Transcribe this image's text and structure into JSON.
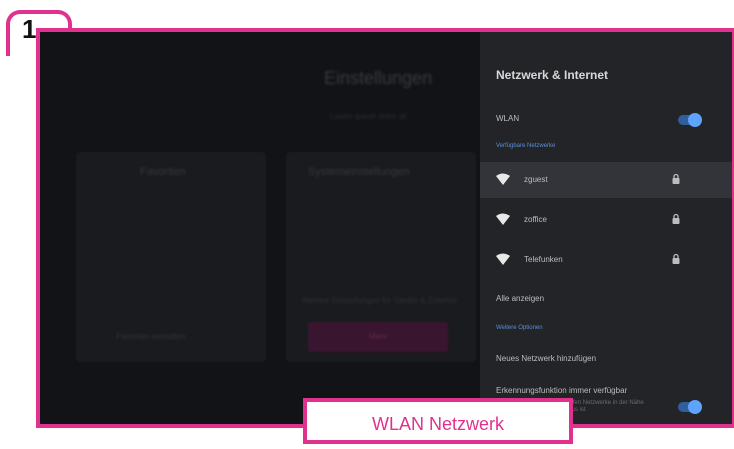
{
  "step": {
    "number": "1"
  },
  "background": {
    "title": "Einstellungen",
    "subtitle": "Lorem ipsum dolor sit",
    "cards": [
      {
        "title": "Favoriten",
        "button_label": "Favoriten verwalten"
      },
      {
        "title": "Systemeinstellungen",
        "button_label": "Mehr"
      }
    ],
    "mini_text": "Weitere Einstellungen für Geräte & Zubehör"
  },
  "panel": {
    "title": "Netzwerk & Internet",
    "wlan_label": "WLAN",
    "wlan_enabled": true,
    "available_label": "Verfügbare Netzwerke",
    "networks": [
      {
        "name": "zguest",
        "secured": true,
        "selected": true
      },
      {
        "name": "zoffice",
        "secured": true,
        "selected": false
      },
      {
        "name": "Telefunken",
        "secured": true,
        "selected": false
      }
    ],
    "show_all_label": "Alle anzeigen",
    "more_options_label": "Weitere Optionen",
    "add_network_label": "Neues Netzwerk hinzufügen",
    "scan_label": "Erkennungsfunktion immer verfügbar",
    "scan_note": "Google und andere Apps dürfen Netzwerke in der Nähe suchen, auch wenn WLAN aus ist",
    "scan_enabled": true
  },
  "caption": {
    "text": "WLAN Netzwerk"
  },
  "colors": {
    "accent": "#e0318f",
    "toggle": "#5ea3ff",
    "panel": "#232427",
    "section": "#5a8fd6"
  }
}
